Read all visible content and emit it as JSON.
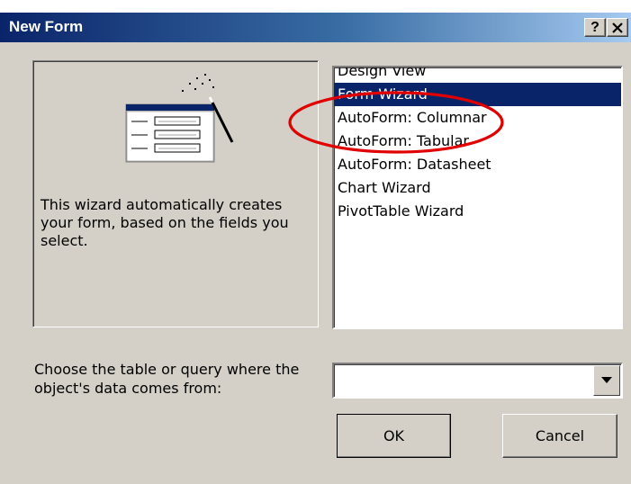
{
  "window": {
    "title": "New Form",
    "help_label": "?",
    "close_label": "✕"
  },
  "preview": {
    "description": "This wizard automatically creates your form, based on the fields you select.",
    "icon": "form-wizard-icon"
  },
  "form_types": {
    "items": [
      {
        "label": "Design View"
      },
      {
        "label": "Form Wizard"
      },
      {
        "label": "AutoForm:  Columnar"
      },
      {
        "label": "AutoForm:  Tabular"
      },
      {
        "label": "AutoForm:  Datasheet"
      },
      {
        "label": "Chart Wizard"
      },
      {
        "label": "PivotTable Wizard"
      }
    ],
    "selected": "Form Wizard"
  },
  "source": {
    "label": "Choose the table or query where the object's data comes from:",
    "value": ""
  },
  "buttons": {
    "ok_label": "OK",
    "cancel_label": "Cancel"
  },
  "annotation": {
    "ellipse_color": "#e00000"
  },
  "colors": {
    "title_bar": "#0a246a",
    "selection": "#0a246a",
    "face": "#d4d0c8"
  }
}
